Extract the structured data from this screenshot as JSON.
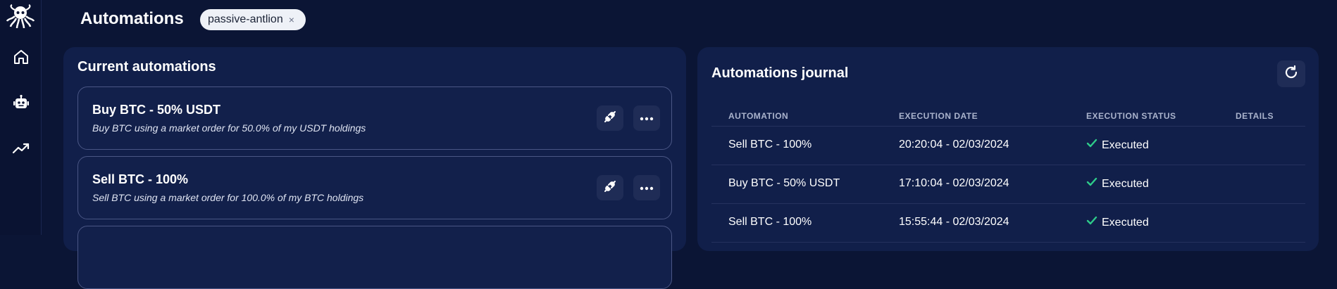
{
  "sidebar": {
    "logo": "octopus-logo-icon",
    "items": [
      {
        "icon": "home-icon"
      },
      {
        "icon": "robot-icon"
      },
      {
        "icon": "trending-up-icon"
      }
    ]
  },
  "header": {
    "title": "Automations",
    "tag": {
      "label": "passive-antlion",
      "close": "×"
    }
  },
  "current": {
    "title": "Current automations",
    "cards": [
      {
        "name": "Buy BTC - 50% USDT",
        "description": "Buy BTC using a market order for 50.0% of my USDT holdings"
      },
      {
        "name": "Sell BTC - 100%",
        "description": "Sell BTC using a market order for 100.0% of my BTC holdings"
      }
    ]
  },
  "journal": {
    "title": "Automations journal",
    "columns": [
      "AUTOMATION",
      "EXECUTION DATE",
      "EXECUTION STATUS",
      "DETAILS"
    ],
    "rows": [
      {
        "automation": "Sell BTC - 100%",
        "date": "20:20:04 - 02/03/2024",
        "status": "Executed",
        "details": ""
      },
      {
        "automation": "Buy BTC - 50% USDT",
        "date": "17:10:04 - 02/03/2024",
        "status": "Executed",
        "details": ""
      },
      {
        "automation": "Sell BTC - 100%",
        "date": "15:55:44 - 02/03/2024",
        "status": "Executed",
        "details": ""
      }
    ]
  },
  "colors": {
    "background": "#0b1535",
    "panel": "#111f4a",
    "success": "#2ecc8a",
    "tag_bg": "#eef1f7"
  }
}
